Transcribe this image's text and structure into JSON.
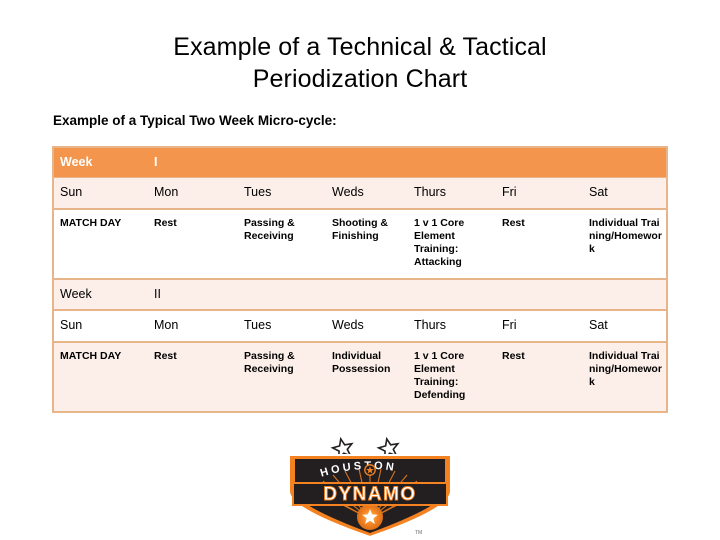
{
  "slide": {
    "title_line1": "Example of a Technical & Tactical",
    "title_line2": "Periodization Chart",
    "subtitle": "Example of a Typical Two Week Micro-cycle:"
  },
  "colors": {
    "header_orange": "#F4954E",
    "row_pink": "#FCEFE9",
    "border_tan": "#E8B48A",
    "logo_orange": "#F58220",
    "logo_black": "#231F20",
    "text_black": "#000000",
    "header_text": "#FFFFFF"
  },
  "table": {
    "week1": {
      "week_label": "Week",
      "week_number": "I",
      "days": [
        "Sun",
        "Mon",
        "Tues",
        "Weds",
        "Thurs",
        "Fri",
        "Sat"
      ],
      "activities": [
        "MATCH DAY",
        "Rest",
        "Passing & Receiving",
        "Shooting & Finishing",
        "1 v 1 Core Element Training: Attacking",
        "Rest",
        "Individual Training/Homework"
      ]
    },
    "week2": {
      "week_label": "Week",
      "week_number": "II",
      "days": [
        "Sun",
        "Mon",
        "Tues",
        "Weds",
        "Thurs",
        "Fri",
        "Sat"
      ],
      "activities": [
        "MATCH DAY",
        "Rest",
        "Passing & Receiving",
        "Individual Possession",
        "1 v 1 Core Element Training: Defending",
        "Rest",
        "Individual Training/Homework"
      ]
    }
  },
  "logo": {
    "club_name": "HOUSTON",
    "club_word": "DYNAMO",
    "trademark": "TM",
    "stars": 2
  }
}
